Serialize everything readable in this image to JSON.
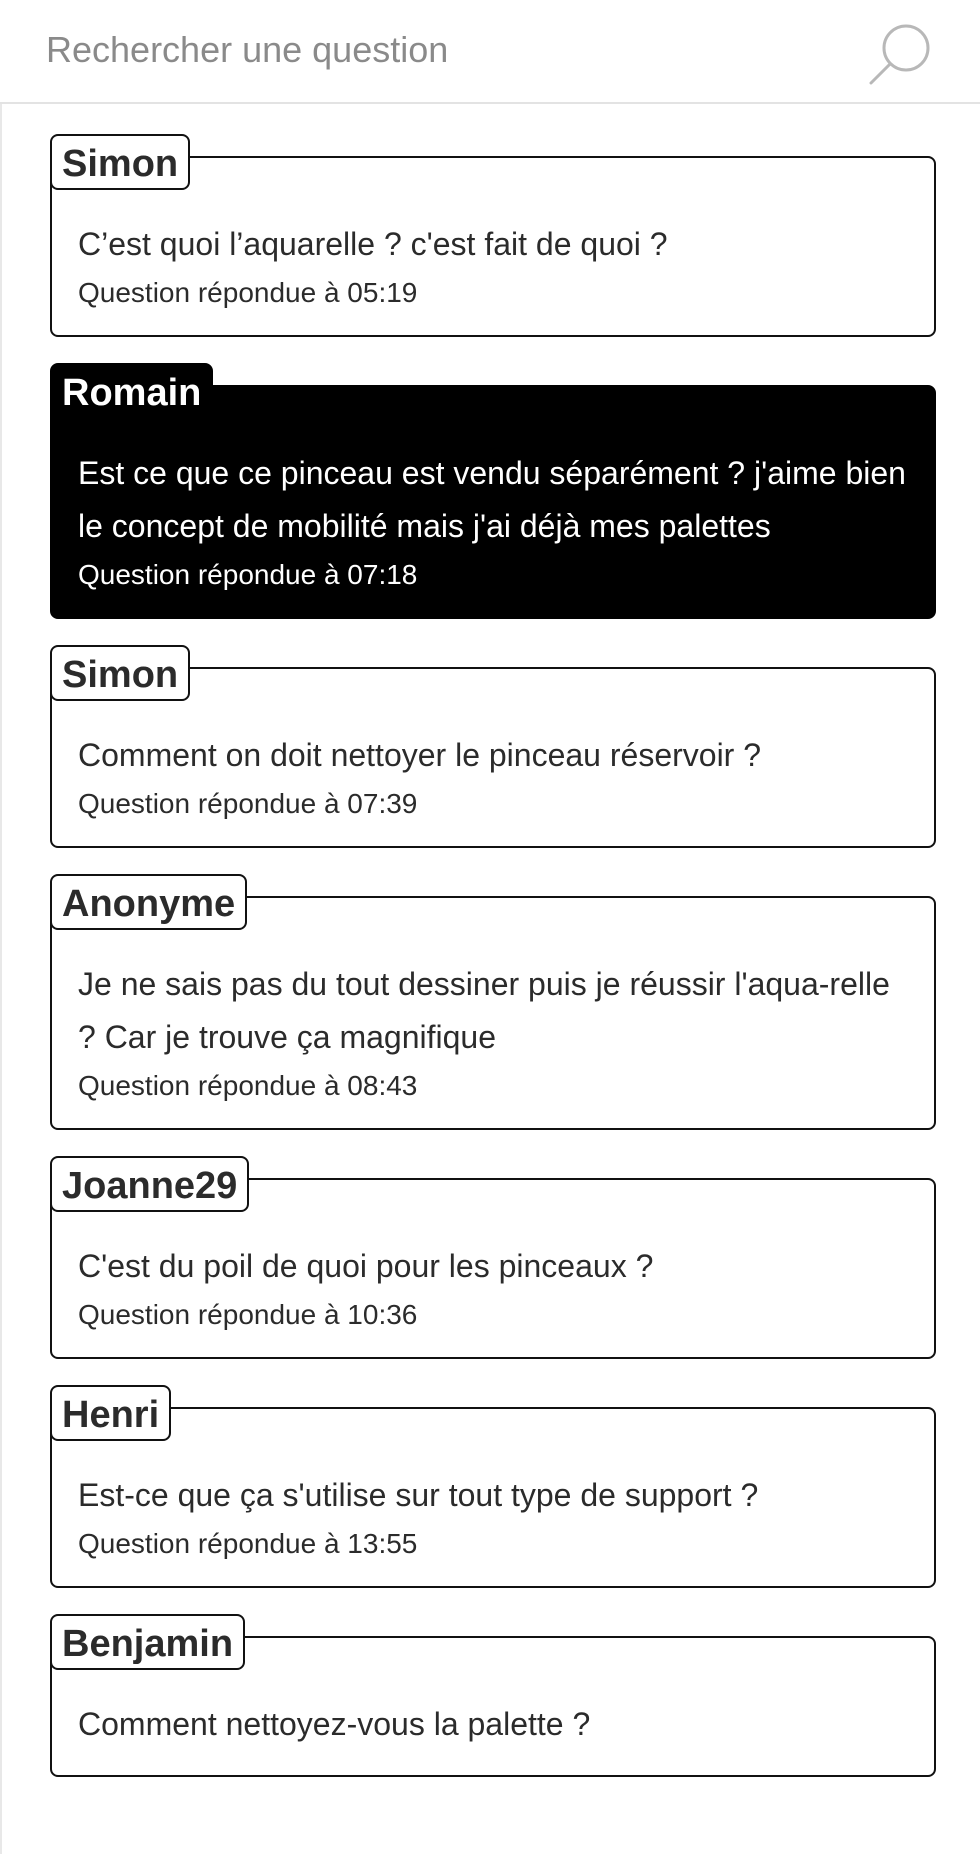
{
  "search": {
    "placeholder": "Rechercher une question",
    "value": "",
    "icon": "search-icon"
  },
  "colors": {
    "text": "#2b2b2b",
    "selected_background": "#000000",
    "selected_text": "#ffffff",
    "card_border": "#111111"
  },
  "questions": [
    {
      "author": "Simon",
      "text": "C’est quoi l’aquarelle ? c'est fait de quoi ?",
      "answered": "Question répondue à 05:19",
      "selected": false
    },
    {
      "author": "Romain",
      "text": "Est ce que ce pinceau est vendu séparément ? j'aime bien le concept de mobilité mais j'ai déjà mes palettes",
      "answered": "Question répondue à 07:18",
      "selected": true
    },
    {
      "author": "Simon",
      "text": "Comment on doit nettoyer le pinceau réservoir ?",
      "answered": "Question répondue à 07:39",
      "selected": false
    },
    {
      "author": "Anonyme",
      "text": "Je ne sais pas du tout dessiner puis je réussir l'aqua-relle ? Car je trouve ça magnifique",
      "answered": "Question répondue à 08:43",
      "selected": false
    },
    {
      "author": "Joanne29",
      "text": "C'est du poil de quoi pour les pinceaux ?",
      "answered": "Question répondue à 10:36",
      "selected": false
    },
    {
      "author": "Henri",
      "text": "Est-ce que ça s'utilise sur tout type de support ?",
      "answered": "Question répondue à 13:55",
      "selected": false
    },
    {
      "author": "Benjamin",
      "text": "Comment nettoyez-vous la palette ?",
      "answered": "",
      "selected": false
    }
  ]
}
